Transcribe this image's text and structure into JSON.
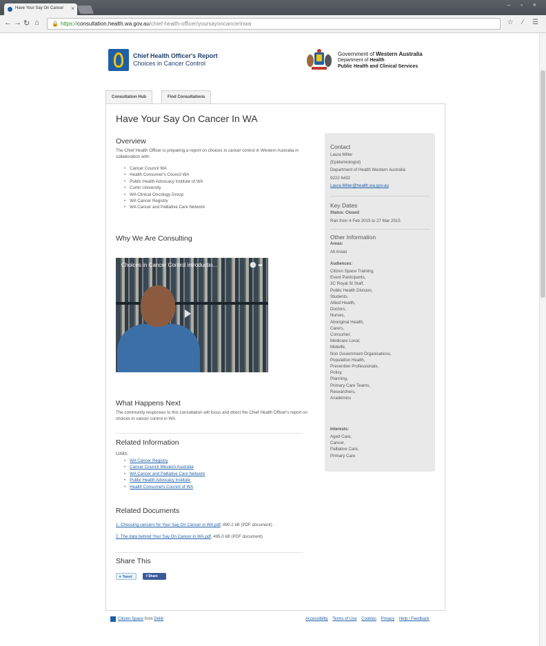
{
  "browser": {
    "tab_title": "Have Your Say On Cancer",
    "tab_close": "×",
    "url_scheme": "https://",
    "url_host": "consultation.health.wa.gov.au",
    "url_path": "/chief-health-officer/yoursayoncancerinwa",
    "window_controls": "– ▫ ×",
    "toolbar_right": "☆ ⁄ ☰"
  },
  "header": {
    "cho_title": "Chief Health Officer's Report",
    "cho_subtitle": "Choices in Cancer Control",
    "gov_line1_pre": "Government of ",
    "gov_line1_bold": "Western Australia",
    "gov_line2_pre": "Department of ",
    "gov_line2_bold": "Health",
    "gov_line3": "Public Health and Clinical Services"
  },
  "tabs": [
    {
      "label": "Consultation Hub"
    },
    {
      "label": "Find Consultations"
    }
  ],
  "main": {
    "title": "Have Your Say On Cancer In WA",
    "overview": {
      "heading": "Overview",
      "intro": "The Chief Health Officer is preparing a report on choices in cancer control in Western Australia in collaboration with:",
      "partners": [
        "Cancer Council WA",
        "Health Consumer's Council WA",
        "Public Health Advocacy Institute of WA",
        "Curtin University",
        "WA Clinical Oncology Group",
        "WA Cancer Registry",
        "WA Cancer and Palliative Care Network"
      ]
    },
    "why": {
      "heading": "Why We Are Consulting",
      "video_title": "Choices in Cancer Control introductio...",
      "video_icons": "🕓 ➦"
    },
    "next": {
      "heading": "What Happens Next",
      "text": "The community responses to this consultation will focus and direct the Chief Health Officer's report on choices in cancer control in WA."
    },
    "related_info": {
      "heading": "Related Information",
      "links_label": "Links:",
      "links": [
        "WA Cancer Registry",
        "Cancer Council Western Australia",
        "WA Cancer and Palliative Care Network",
        "Public Health Advocacy Institute",
        "Health Consumers Council of WA"
      ]
    },
    "related_docs": {
      "heading": "Related Documents",
      "docs": [
        {
          "link": "1. Choosing cancers for Your Say On Cancer in WA.pdf",
          "meta": ", 890.2 kB (PDF document)"
        },
        {
          "link": "2. The data behind Your Say On Cancer in WA.pdf",
          "meta": ", 495.0 kB (PDF document)"
        }
      ]
    },
    "share": {
      "heading": "Share This",
      "tweet": "Tweet",
      "share": "Share"
    }
  },
  "sidebar": {
    "contact_heading": "Contact",
    "contact_name": "Laura Miller",
    "contact_role": "(Epidemiologist)",
    "contact_org": "Department of Health Western Australia",
    "contact_phone": "9222 6432",
    "contact_email": "Laura.Miller@health.wa.gov.au",
    "dates_heading": "Key Dates",
    "status_label": "Status: Closed",
    "dates_text": "Ran from 4 Feb 2015 to 27 Mar 2015",
    "other_heading": "Other Information",
    "areas_label": "Areas:",
    "areas_value": "All Areas",
    "audiences_label": "Audiences:",
    "audiences": [
      "Citizen Space Training,",
      "Event Participants,",
      "3C Royal St Staff,",
      "Public Health Division,",
      "Students,",
      "Allied Health,",
      "Doctors,",
      "Nurses,",
      "Aboriginal Health,",
      "Carers,",
      "Consumer,",
      "Medicare Local,",
      "Midwife,",
      "Non Government Organisations,",
      "Population Health,",
      "Prevention Professionals,",
      "Policy,",
      "Planning,",
      "Primary Care Teams,",
      "Researchers,",
      "Academics"
    ],
    "interests_label": "Interests:",
    "interests": [
      "Aged Care,",
      "Cancer,",
      "Palliative Care,",
      "Primary Care"
    ]
  },
  "footer": {
    "brand_link": "Citizen Space",
    "brand_from": " from ",
    "brand_company": "Delib",
    "links": [
      "Accessibility",
      "Terms of Use",
      "Cookies",
      "Privacy",
      "Help / Feedback"
    ]
  }
}
